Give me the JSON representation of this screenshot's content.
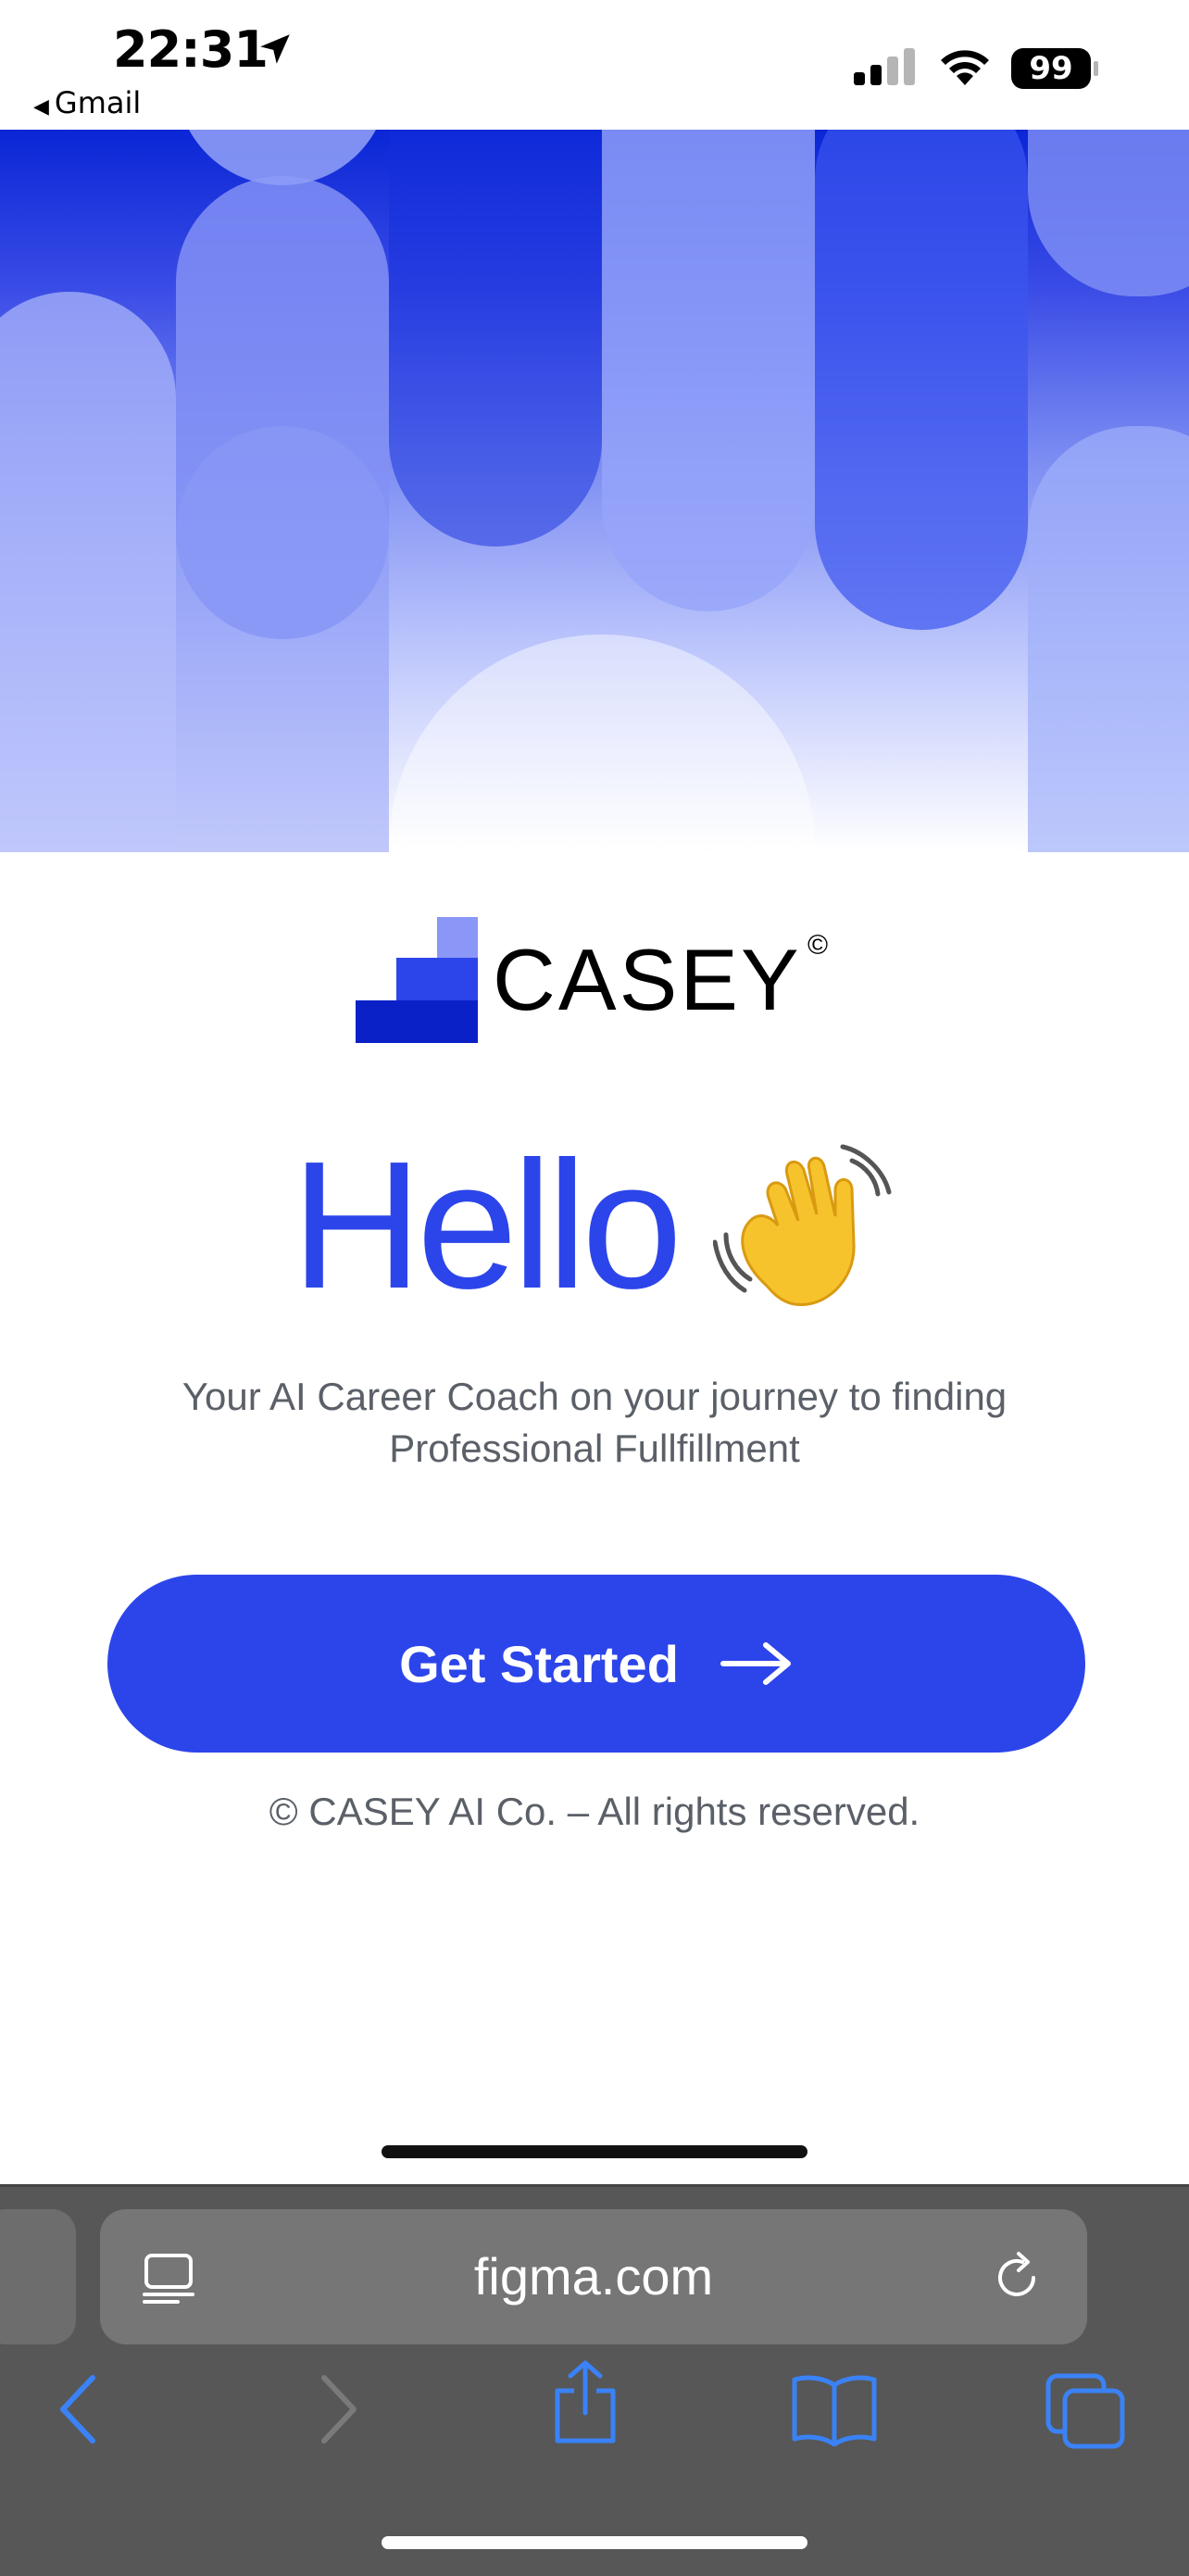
{
  "status_bar": {
    "time": "22:31",
    "back_app": "Gmail",
    "battery": "99"
  },
  "brand": {
    "name": "CASEY",
    "mark": "©",
    "accent": "#2c45ea"
  },
  "hero": {
    "greeting": "Hello",
    "tagline": "Your AI Career Coach on your journey to finding Professional Fullfillment"
  },
  "cta": {
    "label": "Get Started"
  },
  "footer": {
    "copyright": "© CASEY AI Co. – All rights reserved."
  },
  "browser": {
    "url": "figma.com"
  }
}
